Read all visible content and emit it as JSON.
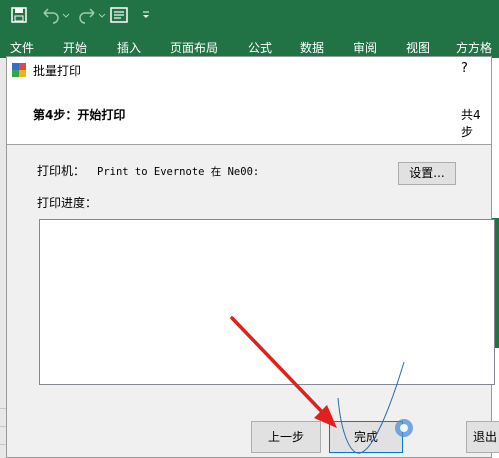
{
  "ribbon": {
    "tabs": [
      "文件",
      "开始",
      "插入",
      "页面布局",
      "公式",
      "数据",
      "审阅",
      "视图",
      "方方格"
    ]
  },
  "dialog": {
    "title": "批量打印",
    "help": "?",
    "step": "第4步：开始打印",
    "total_steps": "共4步",
    "printer_label": "打印机：",
    "printer_value": "Print to Evernote 在 Ne00:",
    "settings_button": "设置...",
    "progress_label": "打印进度：",
    "progress_text": "",
    "buttons": {
      "prev": "上一步",
      "finish": "完成",
      "exit": "退出"
    }
  },
  "colors": {
    "excel_green": "#217346",
    "annotation_red": "#e02020",
    "focus_blue": "#0078d7"
  }
}
